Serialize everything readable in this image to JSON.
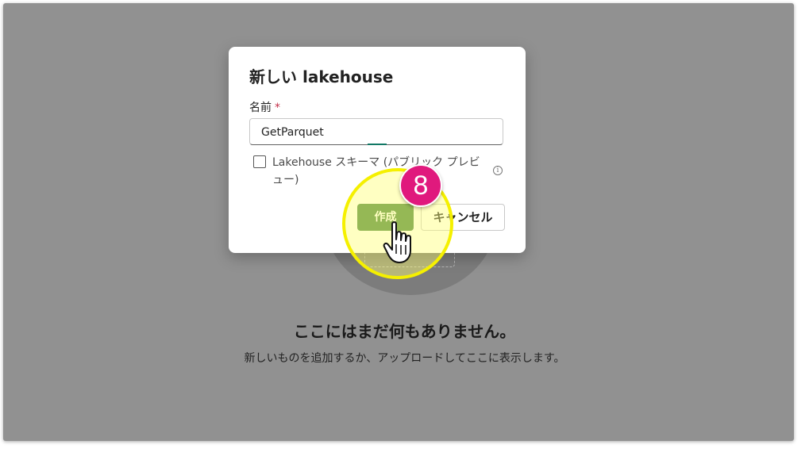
{
  "background": {
    "empty_title": "ここにはまだ何もありません。",
    "empty_subtitle": "新しいものを追加するか、アップロードしてここに表示します。"
  },
  "dialog": {
    "title": "新しい lakehouse",
    "name_label": "名前",
    "required_mark": "*",
    "name_value": "GetParquet",
    "schema_checkbox_label": "Lakehouse スキーマ (パブリック プレビュー)",
    "schema_checkbox_checked": false,
    "info_icon": "i",
    "create_label": "作成",
    "cancel_label": "キャンセル"
  },
  "annotation": {
    "step_number": "8",
    "highlight_color": "#f5f000",
    "badge_color": "#e0197d"
  },
  "colors": {
    "overlay": "#919191",
    "primary_button": "#3f7f3a"
  }
}
